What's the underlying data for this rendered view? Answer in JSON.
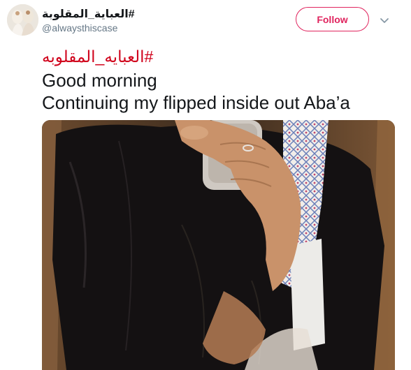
{
  "user": {
    "display_name": "#العباية_المقلوبة",
    "handle": "@alwaysthiscase",
    "avatar_icon": "profile-avatar"
  },
  "actions": {
    "follow_label": "Follow",
    "menu_icon": "chevron-down-icon"
  },
  "tweet": {
    "hashtag": "#العبايه_المقلوبه",
    "line1": "Good morning",
    "line2": "Continuing my flipped inside out Aba’a"
  },
  "colors": {
    "follow_accent": "#e0245e",
    "hashtag": "#d0021b",
    "text": "#14171a",
    "handle": "#657786"
  }
}
